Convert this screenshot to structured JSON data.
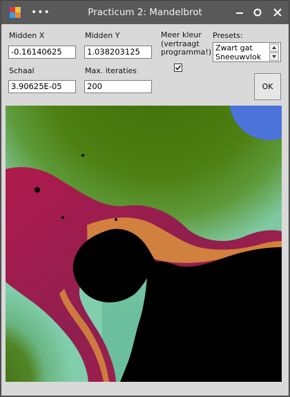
{
  "window": {
    "title": "Practicum 2: Mandelbrot"
  },
  "form": {
    "midden_x_label": "Midden X",
    "midden_x_value": "-0.16140625",
    "midden_y_label": "Midden Y",
    "midden_y_value": "1.038203125",
    "meer_kleur_label": "Meer kleur\n(vertraagt\nprogramma!)",
    "meer_kleur_checked": true,
    "schaal_label": "Schaal",
    "schaal_value": "3.90625E-05",
    "max_iteraties_label": "Max. iteraties",
    "max_iteraties_value": "200",
    "presets_label": "Presets:",
    "presets_options": [
      "Zwart gat",
      "Sneeuwvlok"
    ],
    "ok_label": "OK"
  },
  "colors": {
    "titlebar": "#595959",
    "window_bg": "#d9d9d9",
    "fractal_outer_green": "#4d7f12",
    "fractal_teal": "#73c6a8",
    "fractal_crimson": "#a51d4a",
    "fractal_orange": "#e6a23a",
    "fractal_blue": "#4c73d9",
    "fractal_inside": "#000000"
  },
  "icons": {
    "app": "app-icon",
    "more": "more-dots-icon",
    "minimize": "minimize-icon",
    "maximize": "maximize-icon",
    "close": "close-icon",
    "check": "checkmark-icon",
    "spin_up": "arrow-up-icon",
    "spin_down": "arrow-down-icon"
  }
}
